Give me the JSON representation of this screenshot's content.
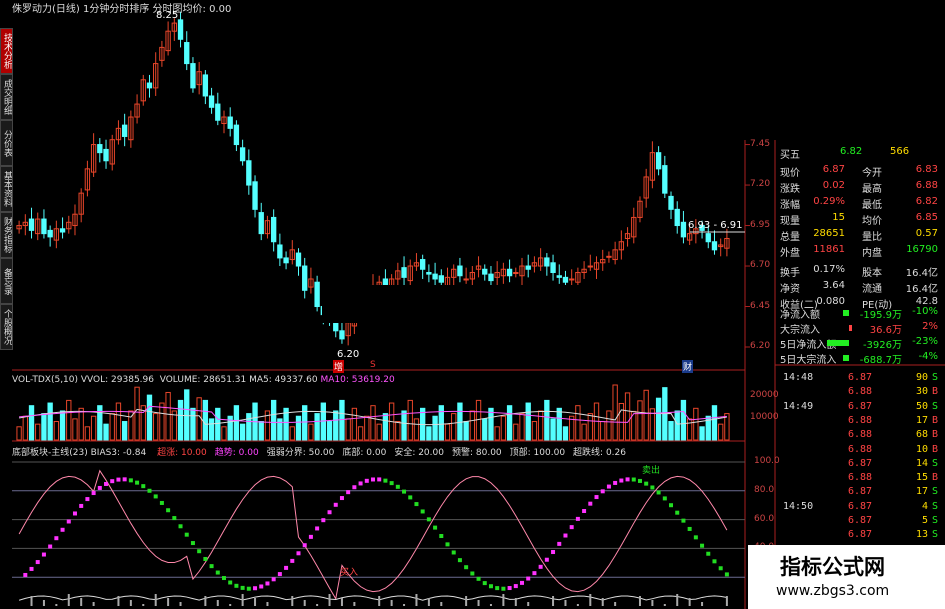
{
  "window": {
    "title": "侏罗动力(日线) 1分钟分时排序 分时图均价: 0.00"
  },
  "side_tabs": [
    "技术分析",
    "成交明细",
    "分价表",
    "基本资料",
    "财务指标",
    "备忘录",
    "个股概况"
  ],
  "price_chart": {
    "high_label": "8.25",
    "low_label": "6.20",
    "range_label": "6.93 - 6.91",
    "axis_labels": [
      "7.45",
      "7.20",
      "6.95",
      "6.70",
      "6.45",
      "6.20"
    ],
    "marker_left": "增",
    "marker_mid": "S",
    "marker_right": "财"
  },
  "volume_panel": {
    "indicator": "VOL-TDX(5,10)",
    "vvol": "VVOL: 29385.96",
    "volume": "VOLUME: 28651.31",
    "ma5": "MA5: 49337.60",
    "ma10": "MA10: 53619.20",
    "axis_labels": [
      "20000",
      "10000"
    ]
  },
  "indicator_panel": {
    "name": "底部板块-主线(23)",
    "bias": "BIAS3: -0.84",
    "items": [
      "超涨: 10.00",
      "趋势: 0.00",
      "强弱分界: 50.00",
      "底部: 0.00",
      "安全: 20.00",
      "预警: 80.00",
      "顶部: 100.00",
      "超跌线: 0.26"
    ],
    "axis_labels": [
      "100.0",
      "80.0",
      "60.0",
      "40.0",
      "20.0"
    ],
    "sell_label": "卖出",
    "buy_label": "买入"
  },
  "quote": {
    "top_row": {
      "label": "买五",
      "price": "6.82",
      "vol": "566"
    },
    "rows": [
      {
        "l1": "现价",
        "v1": "6.87",
        "l2": "今开",
        "v2": "6.83"
      },
      {
        "l1": "涨跌",
        "v1": "0.02",
        "l2": "最高",
        "v2": "6.88"
      },
      {
        "l1": "涨幅",
        "v1": "0.29%",
        "l2": "最低",
        "v2": "6.82"
      },
      {
        "l1": "现量",
        "v1": "15",
        "l2": "均价",
        "v2": "6.85"
      },
      {
        "l1": "总量",
        "v1": "28651",
        "l2": "量比",
        "v2": "0.57"
      },
      {
        "l1": "外盘",
        "v1": "11861",
        "l2": "内盘",
        "v2": "16790"
      },
      {
        "l1": "换手",
        "v1": "0.17%",
        "l2": "股本",
        "v2": "16.4亿"
      },
      {
        "l1": "净资",
        "v1": "3.64",
        "l2": "流通",
        "v2": "16.4亿"
      },
      {
        "l1": "收益(二)",
        "v1": "0.080",
        "l2": "PE(动)",
        "v2": "42.8"
      }
    ],
    "flows": [
      {
        "label": "净流入额",
        "value": "-195.9万",
        "pct": "-10%"
      },
      {
        "label": "大宗流入",
        "value": "36.6万",
        "pct": "2%"
      },
      {
        "label": "5日净流入额",
        "value": "-3926万",
        "pct": "-23%"
      },
      {
        "label": "5日大宗流入",
        "value": "-688.7万",
        "pct": "-4%"
      }
    ]
  },
  "trades": [
    {
      "time": "14:48",
      "price": "6.87",
      "vol": "90",
      "side": "S"
    },
    {
      "time": "",
      "price": "6.88",
      "vol": "30",
      "side": "B"
    },
    {
      "time": "14:49",
      "price": "6.87",
      "vol": "50",
      "side": "S"
    },
    {
      "time": "",
      "price": "6.88",
      "vol": "17",
      "side": "B"
    },
    {
      "time": "",
      "price": "6.88",
      "vol": "68",
      "side": "B"
    },
    {
      "time": "",
      "price": "6.88",
      "vol": "10",
      "side": "B"
    },
    {
      "time": "",
      "price": "6.87",
      "vol": "14",
      "side": "S"
    },
    {
      "time": "",
      "price": "6.88",
      "vol": "15",
      "side": "B"
    },
    {
      "time": "",
      "price": "6.87",
      "vol": "17",
      "side": "S"
    },
    {
      "time": "14:50",
      "price": "6.87",
      "vol": "4",
      "side": "S"
    },
    {
      "time": "",
      "price": "6.87",
      "vol": "5",
      "side": "S"
    },
    {
      "time": "",
      "price": "6.87",
      "vol": "13",
      "side": "S"
    },
    {
      "time": "",
      "price": "6.87",
      "vol": "15",
      "side": "S"
    }
  ],
  "watermark": {
    "title": "指标公式网",
    "url": "www.zbgs3.com"
  },
  "colors": {
    "up": "#e8462a",
    "down": "#54ffff",
    "k_line": "#ff88aa",
    "purple": "#ff33ff",
    "green": "#22dd22",
    "gridline": "#7a1010"
  }
}
